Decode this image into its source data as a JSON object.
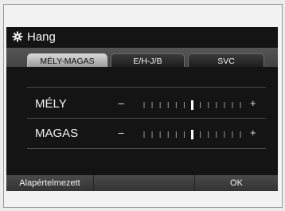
{
  "window": {
    "title": "Hang",
    "title_icon": "gear-icon"
  },
  "tabs": [
    {
      "label": "MÉLY-MAGAS",
      "active": true
    },
    {
      "label": "E/H-J/B",
      "active": false
    },
    {
      "label": "SVC",
      "active": false
    }
  ],
  "controls": [
    {
      "label": "MÉLY",
      "minus": "−",
      "plus": "+",
      "level": 0.5,
      "steps": 13
    },
    {
      "label": "MAGAS",
      "minus": "−",
      "plus": "+",
      "level": 0.5,
      "steps": 13
    }
  ],
  "buttons": {
    "default_label": "Alapértelmezett",
    "ok_label": "OK"
  }
}
